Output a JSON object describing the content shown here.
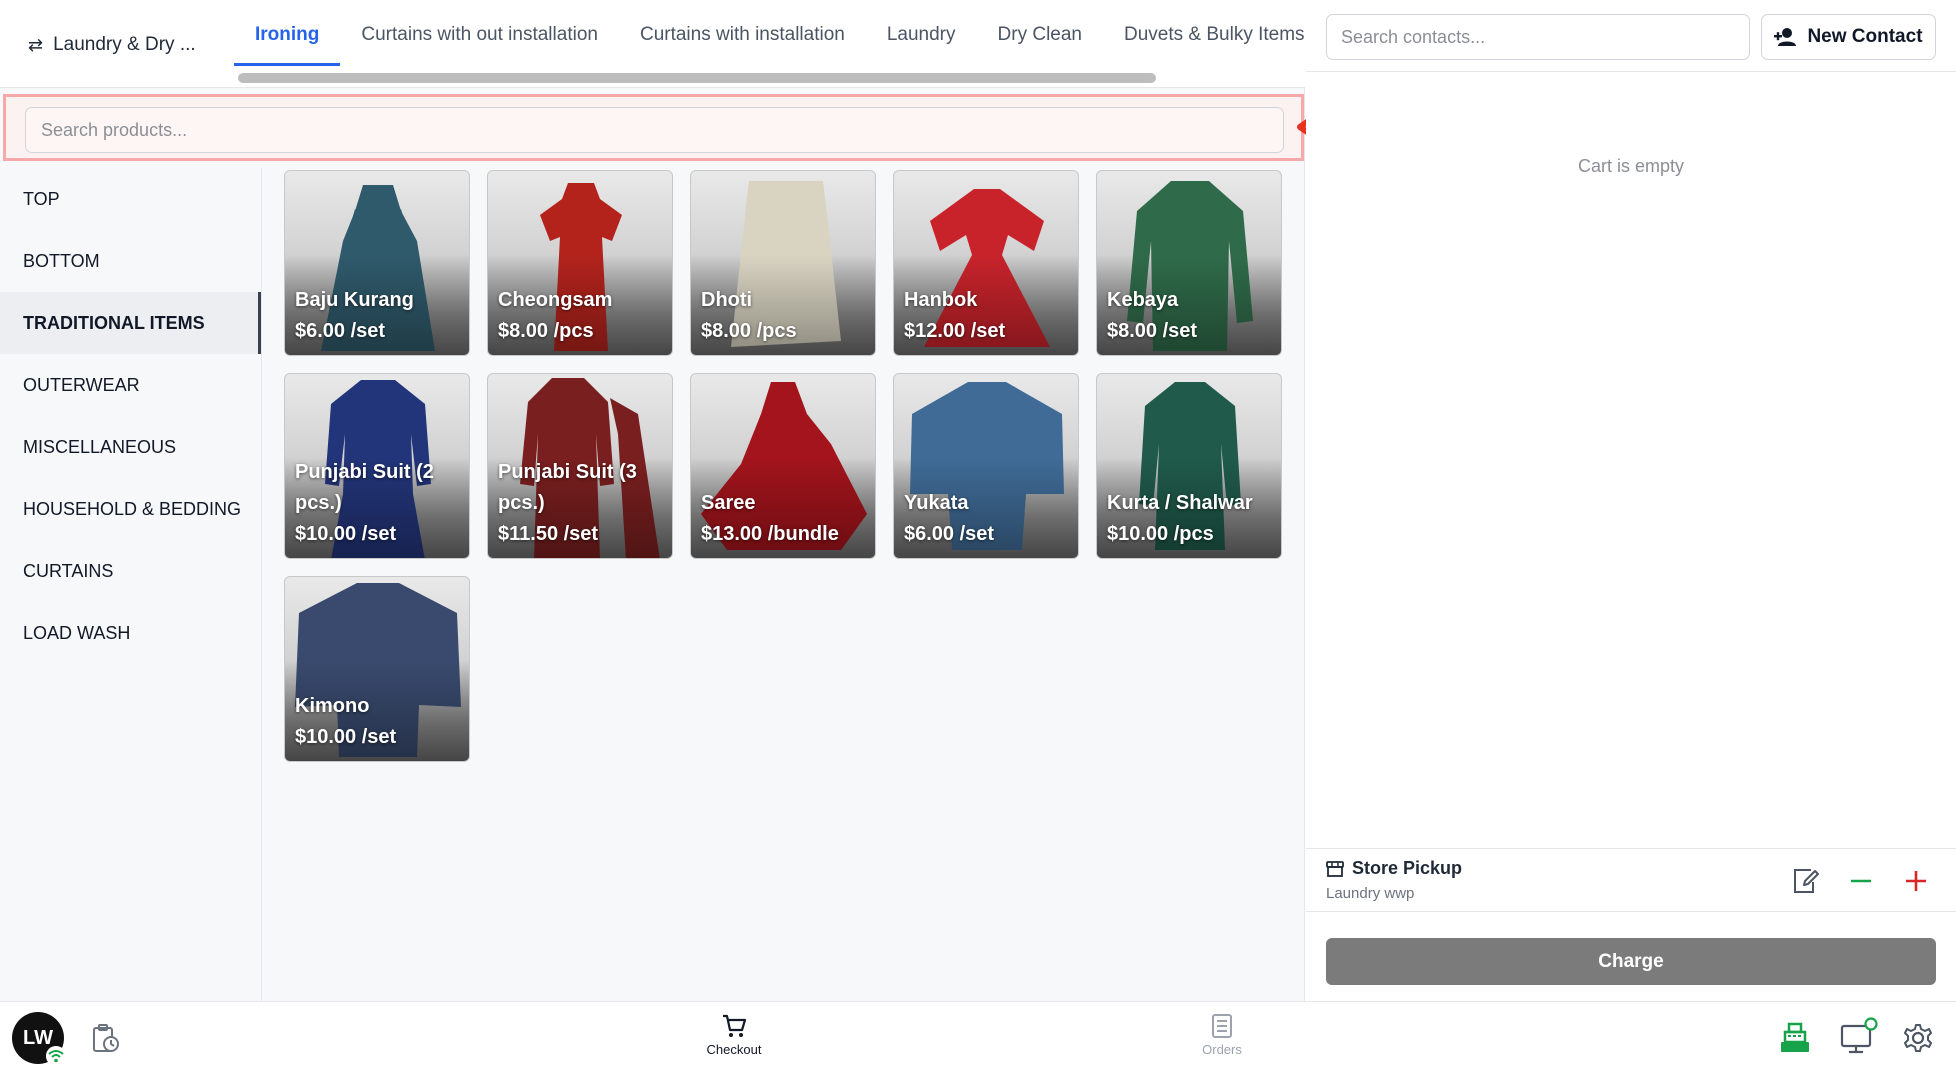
{
  "header": {
    "store_name": "Laundry & Dry ...",
    "swap_icon": "swap-arrows-icon",
    "tabs": [
      {
        "label": "Ironing",
        "active": true
      },
      {
        "label": "Curtains with out installation",
        "active": false
      },
      {
        "label": "Curtains with installation",
        "active": false
      },
      {
        "label": "Laundry",
        "active": false
      },
      {
        "label": "Dry Clean",
        "active": false
      },
      {
        "label": "Duvets & Bulky Items",
        "active": false
      }
    ]
  },
  "search": {
    "placeholder": "Search products..."
  },
  "categories": [
    {
      "label": "TOP",
      "active": false
    },
    {
      "label": "BOTTOM",
      "active": false
    },
    {
      "label": "TRADITIONAL ITEMS",
      "active": true
    },
    {
      "label": "OUTERWEAR",
      "active": false
    },
    {
      "label": "MISCELLANEOUS",
      "active": false
    },
    {
      "label": "HOUSEHOLD & BEDDING",
      "active": false
    },
    {
      "label": "CURTAINS",
      "active": false
    },
    {
      "label": "LOAD WASH",
      "active": false
    }
  ],
  "products": [
    {
      "name": "Baju Kurang",
      "price": "$6.00 /set",
      "color": "#2f5a6b"
    },
    {
      "name": "Cheongsam",
      "price": "$8.00 /pcs",
      "color": "#b3231c"
    },
    {
      "name": "Dhoti",
      "price": "$8.00 /pcs",
      "color": "#d9d4c2"
    },
    {
      "name": "Hanbok",
      "price": "$12.00 /set",
      "color": "#c8232b"
    },
    {
      "name": "Kebaya",
      "price": "$8.00 /set",
      "color": "#2f6b4a"
    },
    {
      "name": "Punjabi Suit (2 pcs.)",
      "price": "$10.00 /set",
      "color": "#23357a"
    },
    {
      "name": "Punjabi Suit (3 pcs.)",
      "price": "$11.50 /set",
      "color": "#7a1f1f"
    },
    {
      "name": "Saree",
      "price": "$13.00 /bundle",
      "color": "#a3141c"
    },
    {
      "name": "Yukata",
      "price": "$6.00 /set",
      "color": "#3f6b96"
    },
    {
      "name": "Kurta / Shalwar",
      "price": "$10.00 /pcs",
      "color": "#1f5a4a"
    },
    {
      "name": "Kimono",
      "price": "$10.00 /set",
      "color": "#394a6e"
    }
  ],
  "cart": {
    "contact_search_placeholder": "Search contacts...",
    "new_contact_label": "New Contact",
    "empty_text": "Cart is empty",
    "pickup_title": "Store Pickup",
    "pickup_subtitle": "Laundry wwp",
    "charge_label": "Charge"
  },
  "bottom_nav": {
    "avatar_initials": "LW",
    "checkout_label": "Checkout",
    "orders_label": "Orders"
  },
  "colors": {
    "accent": "#2563eb",
    "annotation_arrow": "#e8321e",
    "minus": "#16a34a",
    "plus": "#dc2626",
    "charge_button": "#7b7b7b"
  }
}
